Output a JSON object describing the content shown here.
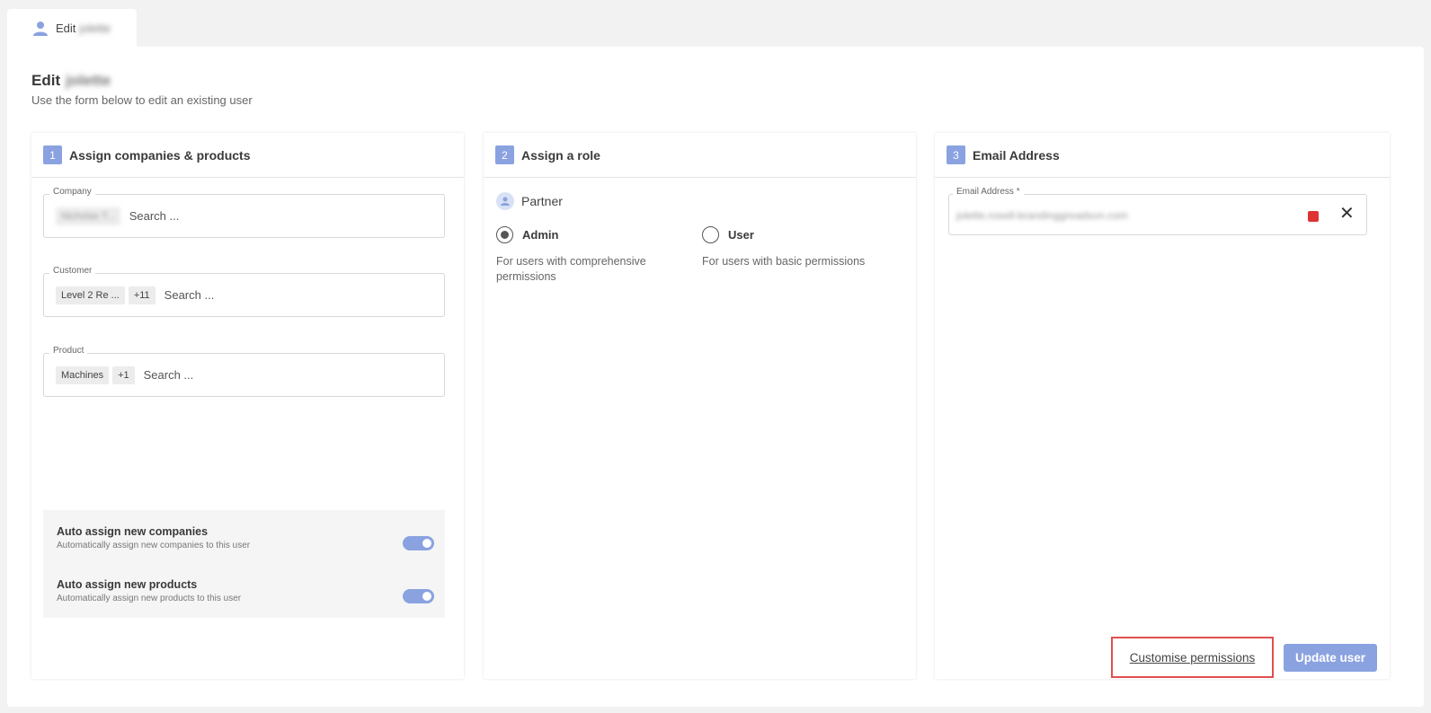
{
  "tab": {
    "label": "Edit",
    "name": "jolette"
  },
  "header": {
    "title": "Edit",
    "name": "jolette",
    "subtitle": "Use the form below to edit an existing user"
  },
  "panel1": {
    "step": "1",
    "title": "Assign companies & products",
    "company": {
      "label": "Company",
      "chips": [
        "Nicholas T..."
      ],
      "placeholder": "Search ..."
    },
    "customer": {
      "label": "Customer",
      "chips": [
        "Level 2 Re ...",
        "+11"
      ],
      "placeholder": "Search ..."
    },
    "product": {
      "label": "Product",
      "chips": [
        "Machines",
        "+1"
      ],
      "placeholder": "Search ..."
    },
    "toggles": [
      {
        "label": "Auto assign new companies",
        "desc": "Automatically assign new companies to this user",
        "on": true
      },
      {
        "label": "Auto assign new products",
        "desc": "Automatically assign new products to this user",
        "on": true
      }
    ]
  },
  "panel2": {
    "step": "2",
    "title": "Assign a role",
    "group": "Partner",
    "roles": [
      {
        "label": "Admin",
        "desc": "For users with comprehensive permissions",
        "selected": true
      },
      {
        "label": "User",
        "desc": "For users with basic permissions",
        "selected": false
      }
    ]
  },
  "panel3": {
    "step": "3",
    "title": "Email Address",
    "email": {
      "label": "Email Address *",
      "value": "jolette.rosell-brandinggreadson.com"
    }
  },
  "footer": {
    "customise_label": "Customise permissions",
    "update_label": "Update user"
  },
  "colors": {
    "accent": "#8aa2e0",
    "highlight": "#e05050"
  }
}
